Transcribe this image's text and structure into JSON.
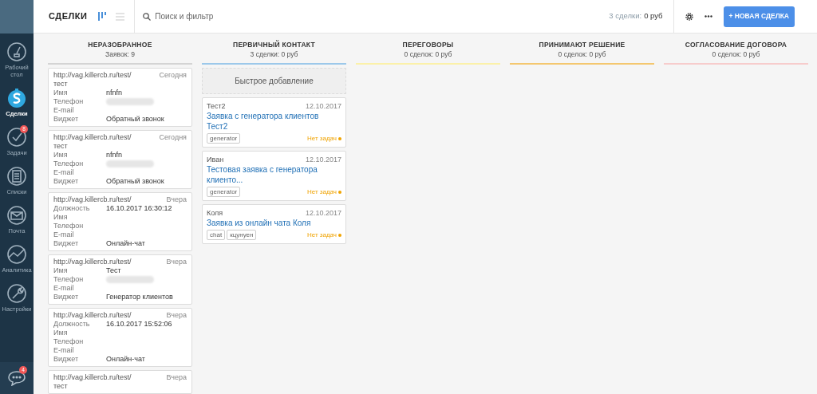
{
  "sidebar": {
    "items": [
      {
        "label": "Рабочий стол",
        "selected": false
      },
      {
        "label": "Сделки",
        "selected": true
      },
      {
        "label": "Задачи",
        "selected": false,
        "badge": "8"
      },
      {
        "label": "Списки",
        "selected": false
      },
      {
        "label": "Почта",
        "selected": false
      },
      {
        "label": "Аналитика",
        "selected": false
      },
      {
        "label": "Настройки",
        "selected": false
      }
    ],
    "chat_badge": "4"
  },
  "header": {
    "title": "СДЕЛКИ",
    "view_modes": [
      {
        "selected": true
      },
      {
        "selected": false
      }
    ],
    "search": {
      "placeholder": "Поиск и фильтр"
    },
    "summary_count": "3 сделки:",
    "summary_sum": "0 руб",
    "new_button": "+ НОВАЯ СДЕЛКА"
  },
  "columns": [
    {
      "title": "НЕРАЗОБРАННОЕ",
      "subtitle": "Заявок: 9",
      "color": "#d4d4d4",
      "cards": [
        {
          "kind": "lead",
          "url": "http://vag.killercb.ru/test/",
          "when": "Сегодня",
          "note": "тест",
          "fields": [
            {
              "label": "Имя",
              "value": "nfnfn"
            },
            {
              "label": "Телефон",
              "redacted": true
            },
            {
              "label": "E-mail"
            },
            {
              "label": "Виджет",
              "value": "Обратный звонок"
            }
          ]
        },
        {
          "kind": "lead",
          "url": "http://vag.killercb.ru/test/",
          "when": "Сегодня",
          "note": "тест",
          "fields": [
            {
              "label": "Имя",
              "value": "nfnfn"
            },
            {
              "label": "Телефон",
              "redacted": true
            },
            {
              "label": "E-mail"
            },
            {
              "label": "Виджет",
              "value": "Обратный звонок"
            }
          ]
        },
        {
          "kind": "lead",
          "url": "http://vag.killercb.ru/test/",
          "when": "Вчера",
          "fields": [
            {
              "label": "Должность",
              "value": "16.10.2017 16:30:12"
            },
            {
              "label": "Имя"
            },
            {
              "label": "Телефон"
            },
            {
              "label": "E-mail"
            },
            {
              "label": "Виджет",
              "value": "Онлайн-чат"
            }
          ]
        },
        {
          "kind": "lead",
          "url": "http://vag.killercb.ru/test/",
          "when": "Вчера",
          "fields": [
            {
              "label": "Имя",
              "value": "Тест"
            },
            {
              "label": "Телефон",
              "redacted": true
            },
            {
              "label": "E-mail"
            },
            {
              "label": "Виджет",
              "value": "Генератор клиентов"
            }
          ]
        },
        {
          "kind": "lead",
          "url": "http://vag.killercb.ru/test/",
          "when": "Вчера",
          "fields": [
            {
              "label": "Должность",
              "value": "16.10.2017 15:52:06"
            },
            {
              "label": "Имя"
            },
            {
              "label": "Телефон"
            },
            {
              "label": "E-mail"
            },
            {
              "label": "Виджет",
              "value": "Онлайн-чат"
            }
          ]
        },
        {
          "kind": "lead",
          "url": "http://vag.killercb.ru/test/",
          "when": "Вчера",
          "note": "тест"
        }
      ]
    },
    {
      "title": "ПЕРВИЧНЫЙ КОНТАКТ",
      "subtitle": "3 сделки: 0 руб",
      "color": "#9cc8ea",
      "quick_add": "Быстрое добавление",
      "cards": [
        {
          "kind": "deal",
          "contact": "Тест2",
          "date": "12.10.2017",
          "title": "Заявка с генератора клиентов Тест2",
          "tags": [
            "generator"
          ],
          "status": "Нет задач"
        },
        {
          "kind": "deal",
          "contact": "Иван",
          "date": "12.10.2017",
          "title": "Тестовая заявка с генератора клиенто...",
          "tags": [
            "generator"
          ],
          "status": "Нет задач"
        },
        {
          "kind": "deal",
          "contact": "Коля",
          "date": "12.10.2017",
          "title": "Заявка из онлайн чата Коля",
          "tags": [
            "chat",
            "кцунуен"
          ],
          "status": "Нет задач"
        }
      ]
    },
    {
      "title": "ПЕРЕГОВОРЫ",
      "subtitle": "0 сделок: 0 руб",
      "color": "#fbf1a9"
    },
    {
      "title": "ПРИНИМАЮТ РЕШЕНИЕ",
      "subtitle": "0 сделок: 0 руб",
      "color": "#f4c76f"
    },
    {
      "title": "СОГЛАСОВАНИЕ ДОГОВОРА",
      "subtitle": "0 сделок: 0 руб",
      "color": "#f7cccc"
    }
  ]
}
